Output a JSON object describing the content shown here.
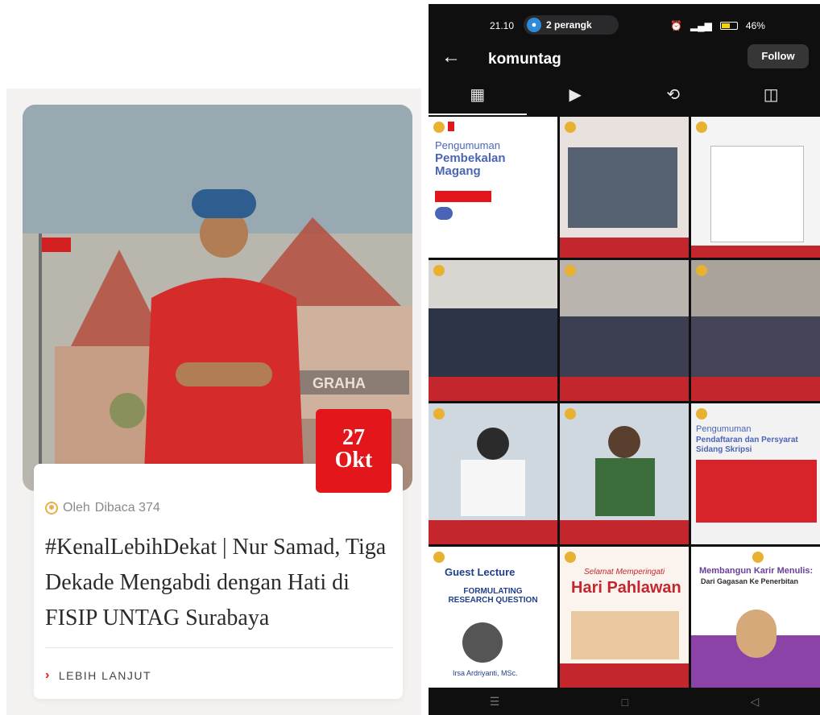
{
  "article": {
    "date_day": "27",
    "date_month": "Okt",
    "author_label": "Oleh",
    "views_label": "Dibaca 374",
    "title": "#KenalLebihDekat | Nur Samad, Tiga Dekade Mengabdi dengan Hati di FISIP UNTAG Surabaya",
    "more_label": "LEBIH LANJUT",
    "hero_sign_text": "GRAHA"
  },
  "phone": {
    "status": {
      "time": "21.10",
      "pill_text": "2 perangk",
      "battery": "46%"
    },
    "profile": {
      "username": "komuntag",
      "follow_label": "Follow"
    },
    "tiles": [
      {
        "heading": "Pengumuman",
        "title": "Pembekalan Magang"
      },
      {
        "heading": "",
        "title": ""
      },
      {
        "heading": "",
        "title": ""
      },
      {
        "heading": "",
        "title": ""
      },
      {
        "heading": "",
        "title": ""
      },
      {
        "heading": "",
        "title": ""
      },
      {
        "heading": "",
        "title": ""
      },
      {
        "heading": "",
        "title": ""
      },
      {
        "heading": "Pengumuman",
        "title": "Pendaftaran dan Persyarat Sidang Skripsi"
      },
      {
        "heading": "Guest Lecture",
        "subtitle": "FORMULATING RESEARCH QUESTION",
        "name": "Irsa Ardriyanti, MSc."
      },
      {
        "heading": "Selamat Memperingati",
        "title": "Hari Pahlawan"
      },
      {
        "heading": "Membangun Karir Menulis:",
        "title": "Dari Gagasan Ke Penerbitan"
      }
    ],
    "colors": {
      "accent": "#e3171b",
      "bg": "#0f0f10"
    }
  }
}
